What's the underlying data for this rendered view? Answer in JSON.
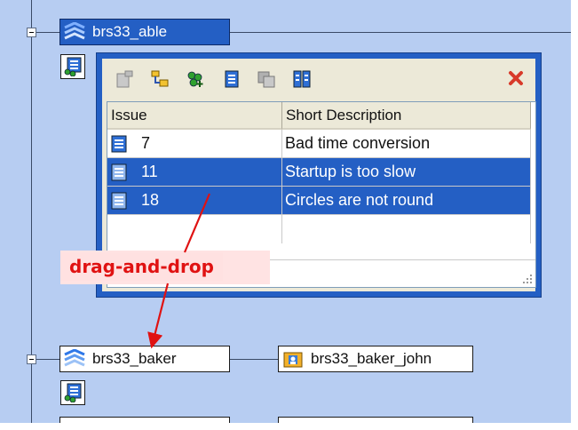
{
  "tree": {
    "node_able": "brs33_able",
    "node_baker": "brs33_baker",
    "node_baker_john": "brs33_baker_john"
  },
  "popup": {
    "columns": [
      "Issue",
      "Short Description"
    ],
    "rows": [
      {
        "issue": "7",
        "desc": "Bad time conversion",
        "selected": false
      },
      {
        "issue": "11",
        "desc": "Startup is too slow",
        "selected": true
      },
      {
        "issue": "18",
        "desc": "Circles are not round",
        "selected": true
      }
    ]
  },
  "annotation": "drag-and-drop",
  "colors": {
    "canvas": "#b7cdf2",
    "selection": "#245fc4",
    "annotation_text": "#e01212",
    "annotation_bg": "#ffe1e1"
  }
}
